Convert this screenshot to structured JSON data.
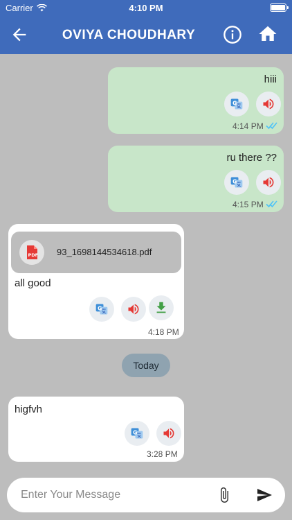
{
  "status_bar": {
    "carrier": "Carrier",
    "time": "4:10 PM"
  },
  "header": {
    "title": "OVIYA CHOUDHARY"
  },
  "messages": [
    {
      "direction": "sent",
      "text": "hiii",
      "time": "4:14 PM"
    },
    {
      "direction": "sent",
      "text": "ru there ??",
      "time": "4:15 PM"
    },
    {
      "direction": "received",
      "attachment": {
        "file_name": "93_1698144534618.pdf",
        "type_label": "PDF"
      },
      "text": "all good",
      "time": "4:18 PM"
    },
    {
      "direction": "received",
      "text": "higfvh",
      "time": "3:28 PM"
    }
  ],
  "date_separator": "Today",
  "composer": {
    "placeholder": "Enter Your Message",
    "value": ""
  },
  "colors": {
    "header": "#3f6bbb",
    "sent_bubble": "#c8e6c9",
    "received_bubble": "#ffffff",
    "background": "#bdbdbd",
    "speaker": "#e53935",
    "translate": "#3f8fd8",
    "download": "#43a047",
    "read_ticks": "#4fc3f7"
  }
}
